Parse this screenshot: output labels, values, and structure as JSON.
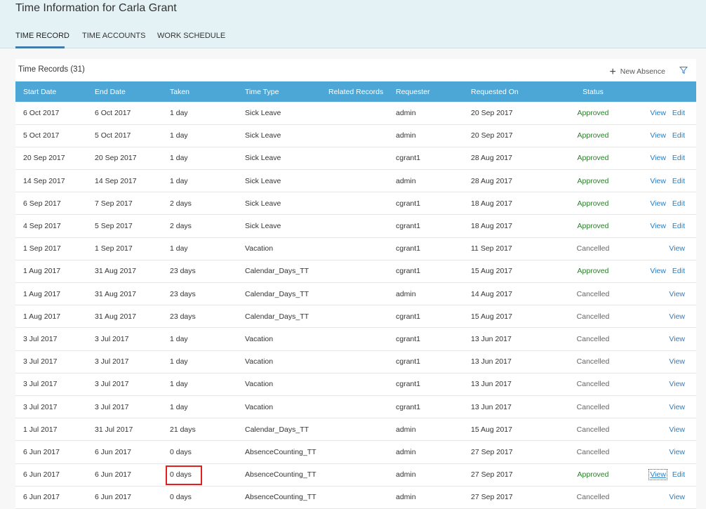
{
  "header": {
    "title": "Time Information for Carla Grant",
    "tabs": [
      {
        "label": "TIME RECORD",
        "active": true
      },
      {
        "label": "TIME ACCOUNTS",
        "active": false
      },
      {
        "label": "WORK SCHEDULE",
        "active": false
      }
    ]
  },
  "toolbar": {
    "records_title": "Time Records (31)",
    "new_absence_label": "New Absence",
    "new_absence_icon": "plus-icon",
    "filter_icon": "filter-icon"
  },
  "colors": {
    "header_bg": "#e5f2f5",
    "table_header_bg": "#4ca6d6",
    "approved": "#2b7d2b",
    "link": "#2a7dc4",
    "highlight": "#e0201f"
  },
  "table": {
    "columns": [
      "Start Date",
      "End Date",
      "Taken",
      "Time Type",
      "Related Records",
      "Requester",
      "Requested On",
      "Status"
    ],
    "rows": [
      {
        "start": "6 Oct 2017",
        "end": "6 Oct 2017",
        "taken": "1 day",
        "type": "Sick Leave",
        "related": "",
        "requester": "admin",
        "requested": "20 Sep 2017",
        "status": "Approved",
        "view": "View",
        "edit": "Edit"
      },
      {
        "start": "5 Oct 2017",
        "end": "5 Oct 2017",
        "taken": "1 day",
        "type": "Sick Leave",
        "related": "",
        "requester": "admin",
        "requested": "20 Sep 2017",
        "status": "Approved",
        "view": "View",
        "edit": "Edit"
      },
      {
        "start": "20 Sep 2017",
        "end": "20 Sep 2017",
        "taken": "1 day",
        "type": "Sick Leave",
        "related": "",
        "requester": "cgrant1",
        "requested": "28 Aug 2017",
        "status": "Approved",
        "view": "View",
        "edit": "Edit"
      },
      {
        "start": "14 Sep 2017",
        "end": "14 Sep 2017",
        "taken": "1 day",
        "type": "Sick Leave",
        "related": "",
        "requester": "admin",
        "requested": "28 Aug 2017",
        "status": "Approved",
        "view": "View",
        "edit": "Edit"
      },
      {
        "start": "6 Sep 2017",
        "end": "7 Sep 2017",
        "taken": "2 days",
        "type": "Sick Leave",
        "related": "",
        "requester": "cgrant1",
        "requested": "18 Aug 2017",
        "status": "Approved",
        "view": "View",
        "edit": "Edit"
      },
      {
        "start": "4 Sep 2017",
        "end": "5 Sep 2017",
        "taken": "2 days",
        "type": "Sick Leave",
        "related": "",
        "requester": "cgrant1",
        "requested": "18 Aug 2017",
        "status": "Approved",
        "view": "View",
        "edit": "Edit"
      },
      {
        "start": "1 Sep 2017",
        "end": "1 Sep 2017",
        "taken": "1 day",
        "type": "Vacation",
        "related": "",
        "requester": "cgrant1",
        "requested": "11 Sep 2017",
        "status": "Cancelled",
        "view": "View",
        "edit": ""
      },
      {
        "start": "1 Aug 2017",
        "end": "31 Aug 2017",
        "taken": "23 days",
        "type": "Calendar_Days_TT",
        "related": "",
        "requester": "cgrant1",
        "requested": "15 Aug 2017",
        "status": "Approved",
        "view": "View",
        "edit": "Edit"
      },
      {
        "start": "1 Aug 2017",
        "end": "31 Aug 2017",
        "taken": "23 days",
        "type": "Calendar_Days_TT",
        "related": "",
        "requester": "admin",
        "requested": "14 Aug 2017",
        "status": "Cancelled",
        "view": "View",
        "edit": ""
      },
      {
        "start": "1 Aug 2017",
        "end": "31 Aug 2017",
        "taken": "23 days",
        "type": "Calendar_Days_TT",
        "related": "",
        "requester": "cgrant1",
        "requested": "15 Aug 2017",
        "status": "Cancelled",
        "view": "View",
        "edit": ""
      },
      {
        "start": "3 Jul 2017",
        "end": "3 Jul 2017",
        "taken": "1 day",
        "type": "Vacation",
        "related": "",
        "requester": "cgrant1",
        "requested": "13 Jun 2017",
        "status": "Cancelled",
        "view": "View",
        "edit": ""
      },
      {
        "start": "3 Jul 2017",
        "end": "3 Jul 2017",
        "taken": "1 day",
        "type": "Vacation",
        "related": "",
        "requester": "cgrant1",
        "requested": "13 Jun 2017",
        "status": "Cancelled",
        "view": "View",
        "edit": ""
      },
      {
        "start": "3 Jul 2017",
        "end": "3 Jul 2017",
        "taken": "1 day",
        "type": "Vacation",
        "related": "",
        "requester": "cgrant1",
        "requested": "13 Jun 2017",
        "status": "Cancelled",
        "view": "View",
        "edit": ""
      },
      {
        "start": "3 Jul 2017",
        "end": "3 Jul 2017",
        "taken": "1 day",
        "type": "Vacation",
        "related": "",
        "requester": "cgrant1",
        "requested": "13 Jun 2017",
        "status": "Cancelled",
        "view": "View",
        "edit": ""
      },
      {
        "start": "1 Jul 2017",
        "end": "31 Jul 2017",
        "taken": "21 days",
        "type": "Calendar_Days_TT",
        "related": "",
        "requester": "admin",
        "requested": "15 Aug 2017",
        "status": "Cancelled",
        "view": "View",
        "edit": ""
      },
      {
        "start": "6 Jun 2017",
        "end": "6 Jun 2017",
        "taken": "0 days",
        "type": "AbsenceCounting_TT",
        "related": "",
        "requester": "admin",
        "requested": "27 Sep 2017",
        "status": "Cancelled",
        "view": "View",
        "edit": ""
      },
      {
        "start": "6 Jun 2017",
        "end": "6 Jun 2017",
        "taken": "0 days",
        "type": "AbsenceCounting_TT",
        "related": "",
        "requester": "admin",
        "requested": "27 Sep 2017",
        "status": "Approved",
        "view": "View",
        "edit": "Edit",
        "focused": true
      },
      {
        "start": "6 Jun 2017",
        "end": "6 Jun 2017",
        "taken": "0 days",
        "type": "AbsenceCounting_TT",
        "related": "",
        "requester": "admin",
        "requested": "27 Sep 2017",
        "status": "Cancelled",
        "view": "View",
        "edit": ""
      }
    ]
  }
}
